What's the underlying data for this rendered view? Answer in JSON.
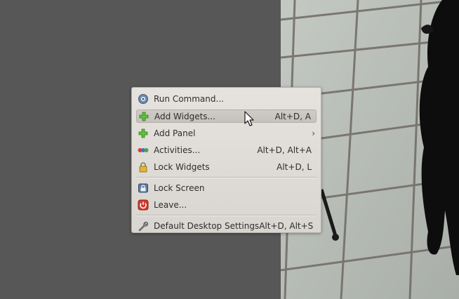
{
  "menu": {
    "items": [
      {
        "label": "Run Command...",
        "shortcut": "",
        "icon": "run-command-icon"
      },
      {
        "label": "Add Widgets...",
        "shortcut": "Alt+D, A",
        "icon": "plus-icon"
      },
      {
        "label": "Add Panel",
        "shortcut": "",
        "icon": "plus-icon",
        "submenu_arrow": "›"
      },
      {
        "label": "Activities...",
        "shortcut": "Alt+D, Alt+A",
        "icon": "activities-icon"
      },
      {
        "label": "Lock Widgets",
        "shortcut": "Alt+D, L",
        "icon": "padlock-icon"
      },
      {
        "label": "Lock Screen",
        "shortcut": "",
        "icon": "lock-screen-icon"
      },
      {
        "label": "Leave...",
        "shortcut": "",
        "icon": "power-icon"
      },
      {
        "label": "Default Desktop Settings",
        "shortcut": "Alt+D, Alt+S",
        "icon": "wrench-icon"
      }
    ]
  },
  "colors": {
    "desktop": "#575757",
    "menu_bg": "#e0ddd9",
    "highlight": "#c9c5bf",
    "plus_green": "#4caf32",
    "power_red": "#d23a2a"
  }
}
